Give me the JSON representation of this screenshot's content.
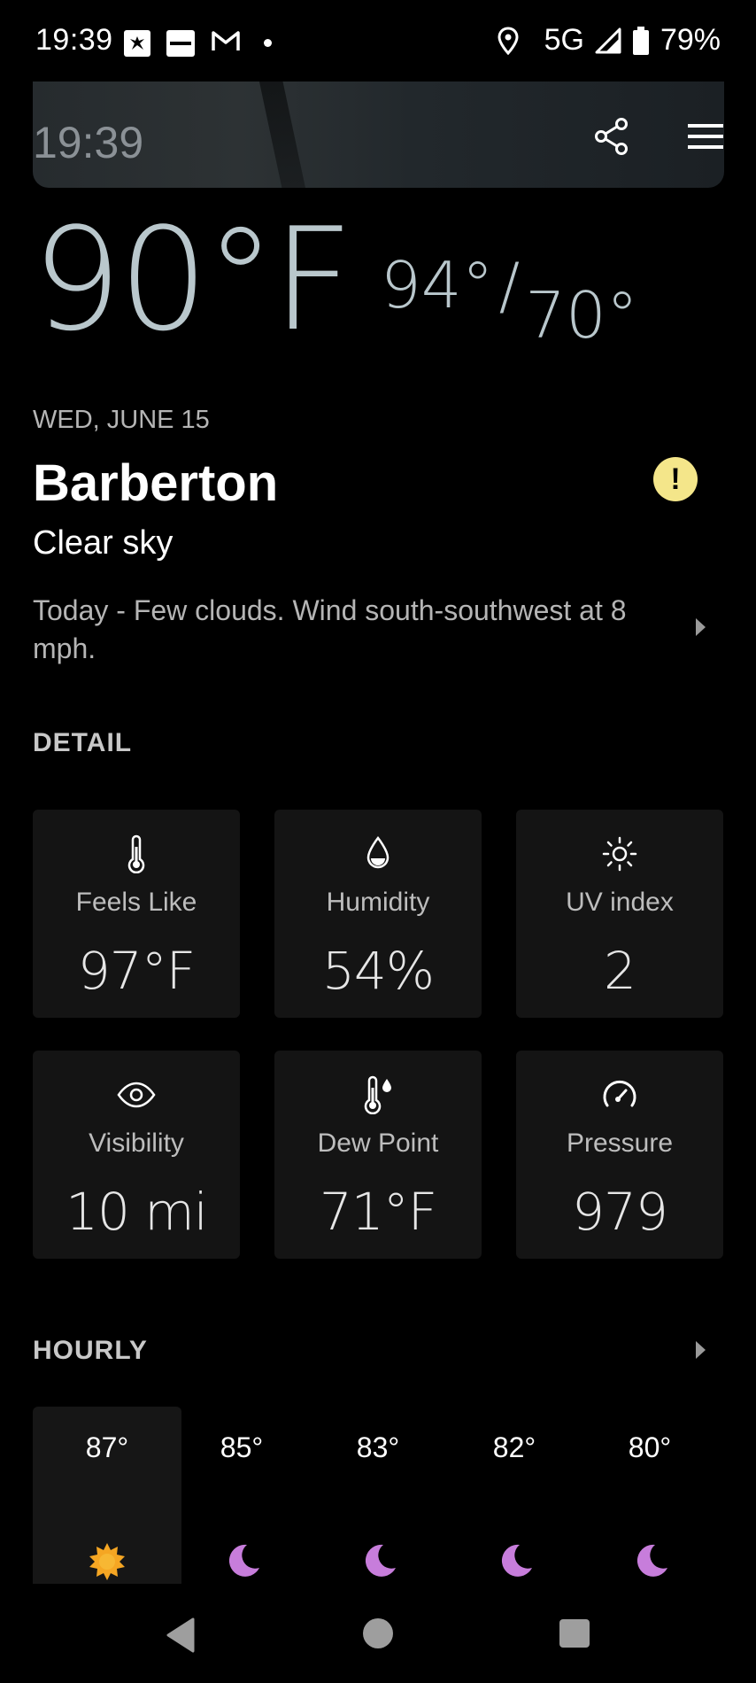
{
  "status_bar": {
    "time": "19:39",
    "network": "5G",
    "battery": "79%",
    "notification_icons": [
      "jcpenney-icon",
      "kohls-icon",
      "gmail-icon",
      "dot-icon"
    ],
    "right_icons": [
      "location-icon",
      "signal-icon",
      "battery-icon"
    ]
  },
  "header": {
    "time": "19:39",
    "share_icon": "share-icon",
    "menu_icon": "menu-icon"
  },
  "current": {
    "temperature": "90°F",
    "high": "94°",
    "separator": "/",
    "low": "70°",
    "date": "WED, JUNE 15",
    "city": "Barberton",
    "alert_symbol": "!",
    "condition": "Clear sky",
    "summary": "Today - Few clouds. Wind south-southwest at 8 mph."
  },
  "detail": {
    "title": "DETAIL",
    "tiles": [
      {
        "label": "Feels Like",
        "value": "97°F",
        "icon": "thermometer-icon"
      },
      {
        "label": "Humidity",
        "value": "54%",
        "icon": "water-drop-icon"
      },
      {
        "label": "UV index",
        "value": "2",
        "icon": "sun-icon"
      },
      {
        "label": "Visibility",
        "value": "10 mi",
        "icon": "eye-icon"
      },
      {
        "label": "Dew Point",
        "value": "71°F",
        "icon": "dew-point-icon"
      },
      {
        "label": "Pressure",
        "value": "979",
        "icon": "gauge-icon"
      }
    ]
  },
  "hourly": {
    "title": "HOURLY",
    "items": [
      {
        "temp": "87°",
        "icon": "sun-icon",
        "color": "#f5a623"
      },
      {
        "temp": "85°",
        "icon": "moon-icon",
        "color": "#c77ddb"
      },
      {
        "temp": "83°",
        "icon": "moon-icon",
        "color": "#c77ddb"
      },
      {
        "temp": "82°",
        "icon": "moon-icon",
        "color": "#c77ddb"
      },
      {
        "temp": "80°",
        "icon": "moon-icon",
        "color": "#c77ddb"
      }
    ]
  },
  "colors": {
    "background": "#000000",
    "temperature": "#b9c7cc",
    "alert": "#f4e68a",
    "tile_background": "#141414",
    "moon": "#c77ddb",
    "sun": "#f5a623"
  }
}
